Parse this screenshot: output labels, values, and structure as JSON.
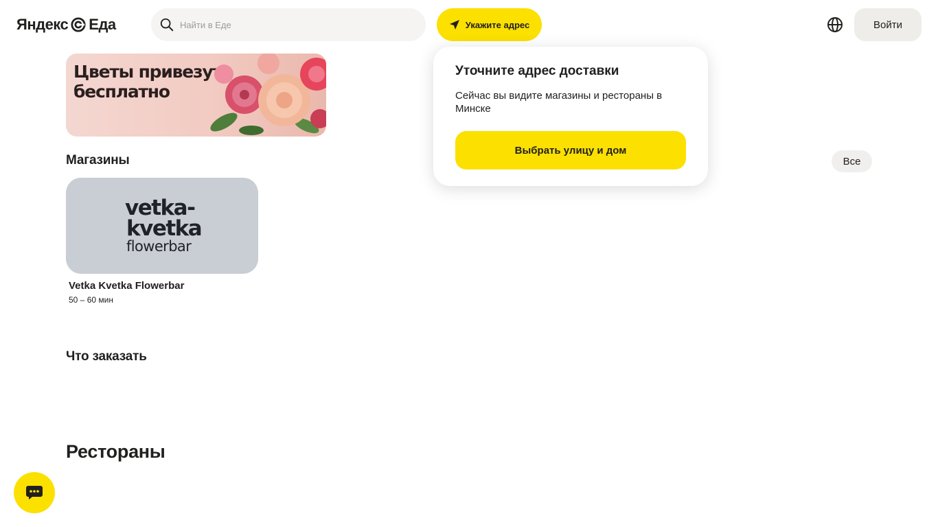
{
  "header": {
    "logo_text": "Яндекс",
    "logo_suffix": "Еда",
    "search_placeholder": "Найти в Еде",
    "address_button": "Укажите адрес",
    "login_button": "Войти"
  },
  "banner": {
    "title": "Цветы привезут\nбесплатно"
  },
  "shops": {
    "title": "Магазины",
    "all_button": "Все",
    "items": [
      {
        "logo_line1": "vetka-",
        "logo_line2": "kvetka",
        "logo_line3": "flowerbar",
        "name": "Vetka Kvetka Flowerbar",
        "delivery_time": "50 – 60 мин"
      }
    ]
  },
  "what_to_order": {
    "title": "Что заказать"
  },
  "restaurants": {
    "title": "Рестораны"
  },
  "popover": {
    "title": "Уточните адрес доставки",
    "text": "Сейчас вы видите магазины и рестораны в Минске",
    "button": "Выбрать улицу и дом"
  },
  "colors": {
    "accent": "#fce000",
    "text": "#21201f",
    "muted": "#9e9b98",
    "card_bg": "#c9cdd4"
  },
  "icons": [
    "search-icon",
    "location-arrow-icon",
    "globe-icon",
    "chat-icon",
    "yandex-eda-logo-icon"
  ]
}
